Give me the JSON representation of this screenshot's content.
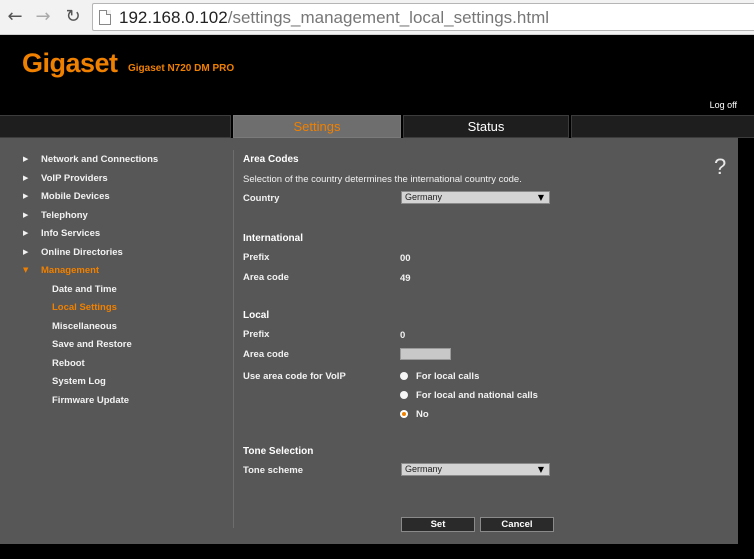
{
  "browser": {
    "url_host": "192.168.0.102",
    "url_path": "/settings_management_local_settings.html"
  },
  "header": {
    "logo": "Gigaset",
    "model": "Gigaset N720 DM PRO",
    "logoff": "Log off"
  },
  "tabs": {
    "settings": "Settings",
    "status": "Status"
  },
  "sidebar": {
    "items": [
      {
        "label": "Network and Connections"
      },
      {
        "label": "VoIP Providers"
      },
      {
        "label": "Mobile Devices"
      },
      {
        "label": "Telephony"
      },
      {
        "label": "Info Services"
      },
      {
        "label": "Online Directories"
      },
      {
        "label": "Management"
      }
    ],
    "sub_items": [
      {
        "label": "Date and Time"
      },
      {
        "label": "Local Settings"
      },
      {
        "label": "Miscellaneous"
      },
      {
        "label": "Save and Restore"
      },
      {
        "label": "Reboot"
      },
      {
        "label": "System Log"
      },
      {
        "label": "Firmware Update"
      }
    ]
  },
  "main": {
    "help": "?",
    "area_codes": {
      "heading": "Area Codes",
      "description": "Selection of the country determines the international country code.",
      "country_label": "Country",
      "country_value": "Germany"
    },
    "international": {
      "heading": "International",
      "prefix_label": "Prefix",
      "prefix_value": "00",
      "area_code_label": "Area code",
      "area_code_value": "49"
    },
    "local": {
      "heading": "Local",
      "prefix_label": "Prefix",
      "prefix_value": "0",
      "area_code_label": "Area code",
      "area_code_value": "",
      "voip_label": "Use area code for VoIP",
      "options": [
        "For local calls",
        "For local and national calls",
        "No"
      ],
      "selected_option": "No"
    },
    "tone": {
      "heading": "Tone Selection",
      "scheme_label": "Tone scheme",
      "scheme_value": "Germany"
    },
    "buttons": {
      "set": "Set",
      "cancel": "Cancel"
    }
  },
  "colors": {
    "accent": "#f08000",
    "panel": "#575757",
    "background": "#000000"
  }
}
